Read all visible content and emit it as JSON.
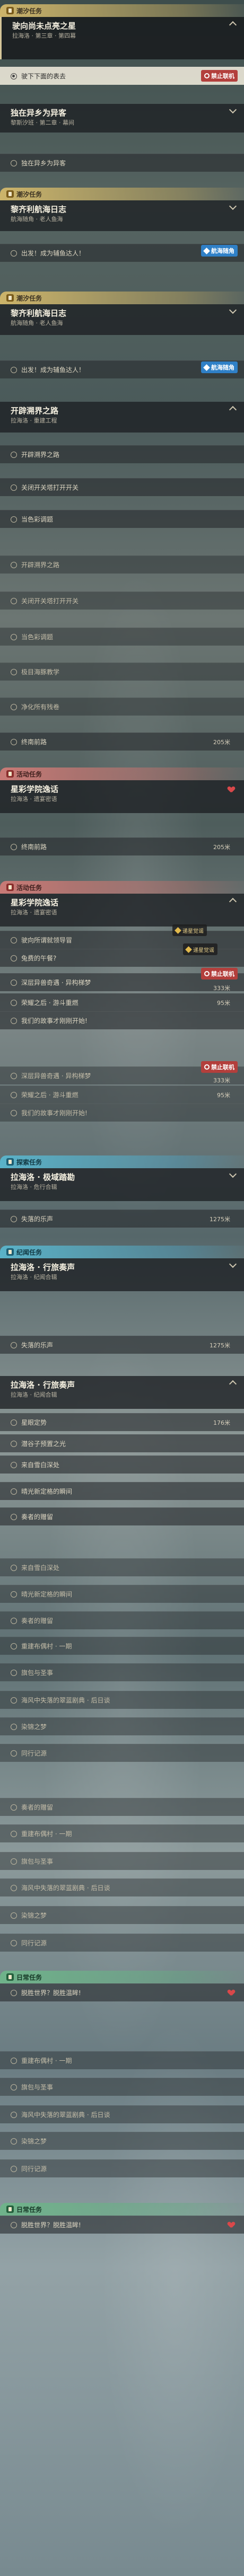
{
  "cat": {
    "main": "潮汐任务",
    "event": "活动任务",
    "world": "探索任务",
    "legend": "纪闻任务",
    "daily": "日常任务"
  },
  "q1": {
    "title": "驶向尚未点亮之星",
    "sub": "拉海洛 · 第三章 · 第四幕",
    "step": "驶下下面的表去"
  },
  "q2": {
    "title": "独在异乡为异客",
    "sub": "黎斯汐班 · 第二章 · 幕间",
    "step": "独在异乡为异客"
  },
  "q3": {
    "title": "黎齐利航海日志",
    "sub": "航海随角 · 老人鱼海",
    "step": "出发！成为辅鱼达人！"
  },
  "q4": {
    "title": "黎齐利航海日志",
    "sub": "航海随角 · 老人鱼海",
    "step": "出发！成为辅鱼达人！"
  },
  "q5": {
    "title": "开辟溯界之路",
    "sub": "拉海洛 · 重建工程",
    "steps": [
      "开辟溯界之路",
      "关闭开关塔打开开关",
      "当色彩调题",
      "开辟溯界之路",
      "关闭开关塔打开开关",
      "当色彩调题",
      "极目海豚教学",
      "净化所有残卷",
      "终南前路"
    ]
  },
  "q6": {
    "title": "星彩学院逸话",
    "sub": "拉海洛 · 遗宴密语",
    "step": "终南前路"
  },
  "q7": {
    "title": "星彩学院逸话",
    "sub": "拉海洛 · 遗宴密语",
    "steps": [
      "驶向所谓就领导冒",
      "兔费的午餐?",
      "深层异兽奇遇 · 异构梯梦",
      "荣耀之后 · 游斗重燃",
      "我们的故事才刚刚开始!",
      "深层异兽奇遇 · 异构梯梦",
      "荣耀之后 · 游斗重燃",
      "我们的故事才刚刚开始!"
    ]
  },
  "q8": {
    "title": "拉海洛 · 极域踏勘",
    "sub": "拉海洛 · 危行合辑",
    "step": "失落的乐声"
  },
  "q9": {
    "title": "拉海洛 · 行旅奏声",
    "sub": "拉海洛 · 纪闻合辑",
    "step": "失落的乐声"
  },
  "q10": {
    "title": "拉海洛 · 行旅奏声",
    "sub": "拉海洛 · 纪闻合辑",
    "steps": [
      "星眼定势",
      "潜谷子预置之光",
      "来自雪白深处",
      "晴光新定格的瞬间",
      "奏者的赠留",
      "来自雪白深处",
      "晴光新定格的瞬间",
      "奏者的赠留",
      "重建布偶村 · 一期",
      "旗包与圣事",
      "海风中失落的翠蓝剧典 · 后日谈",
      "染锦之梦",
      "同行记源",
      "奏者的赠留",
      "重建布偶村 · 一期",
      "旗包与圣事",
      "海风中失落的翠蓝剧典 · 后日谈",
      "染锦之梦",
      "同行记源"
    ]
  },
  "q11": {
    "step": "脱胜世界？脱胜温眸!",
    "steps": [
      "重建布偶村 · 一期",
      "旗包与圣事",
      "海风中失落的翠蓝剧典 · 后日谈",
      "染锦之梦",
      "同行记源"
    ]
  },
  "q12": {
    "step": "脱胜世界？脱胜温眸!"
  },
  "badges": {
    "ban": "禁止联机",
    "nav": "航海随角",
    "recommend": "递星觉谣"
  },
  "dist": {
    "d1": "205米",
    "d2": "205米",
    "d3": "333米",
    "d4": "95米",
    "d5": "333米",
    "d6": "95米",
    "d7": "1275米",
    "d8": "1275米",
    "d9": "176米"
  },
  "colors": {
    "main": "#ccb46a",
    "event": "#c97a76",
    "world": "#5ab2c8",
    "daily": "#6fb38a",
    "ban": "#b33f3c",
    "nav": "#2f80c7"
  }
}
